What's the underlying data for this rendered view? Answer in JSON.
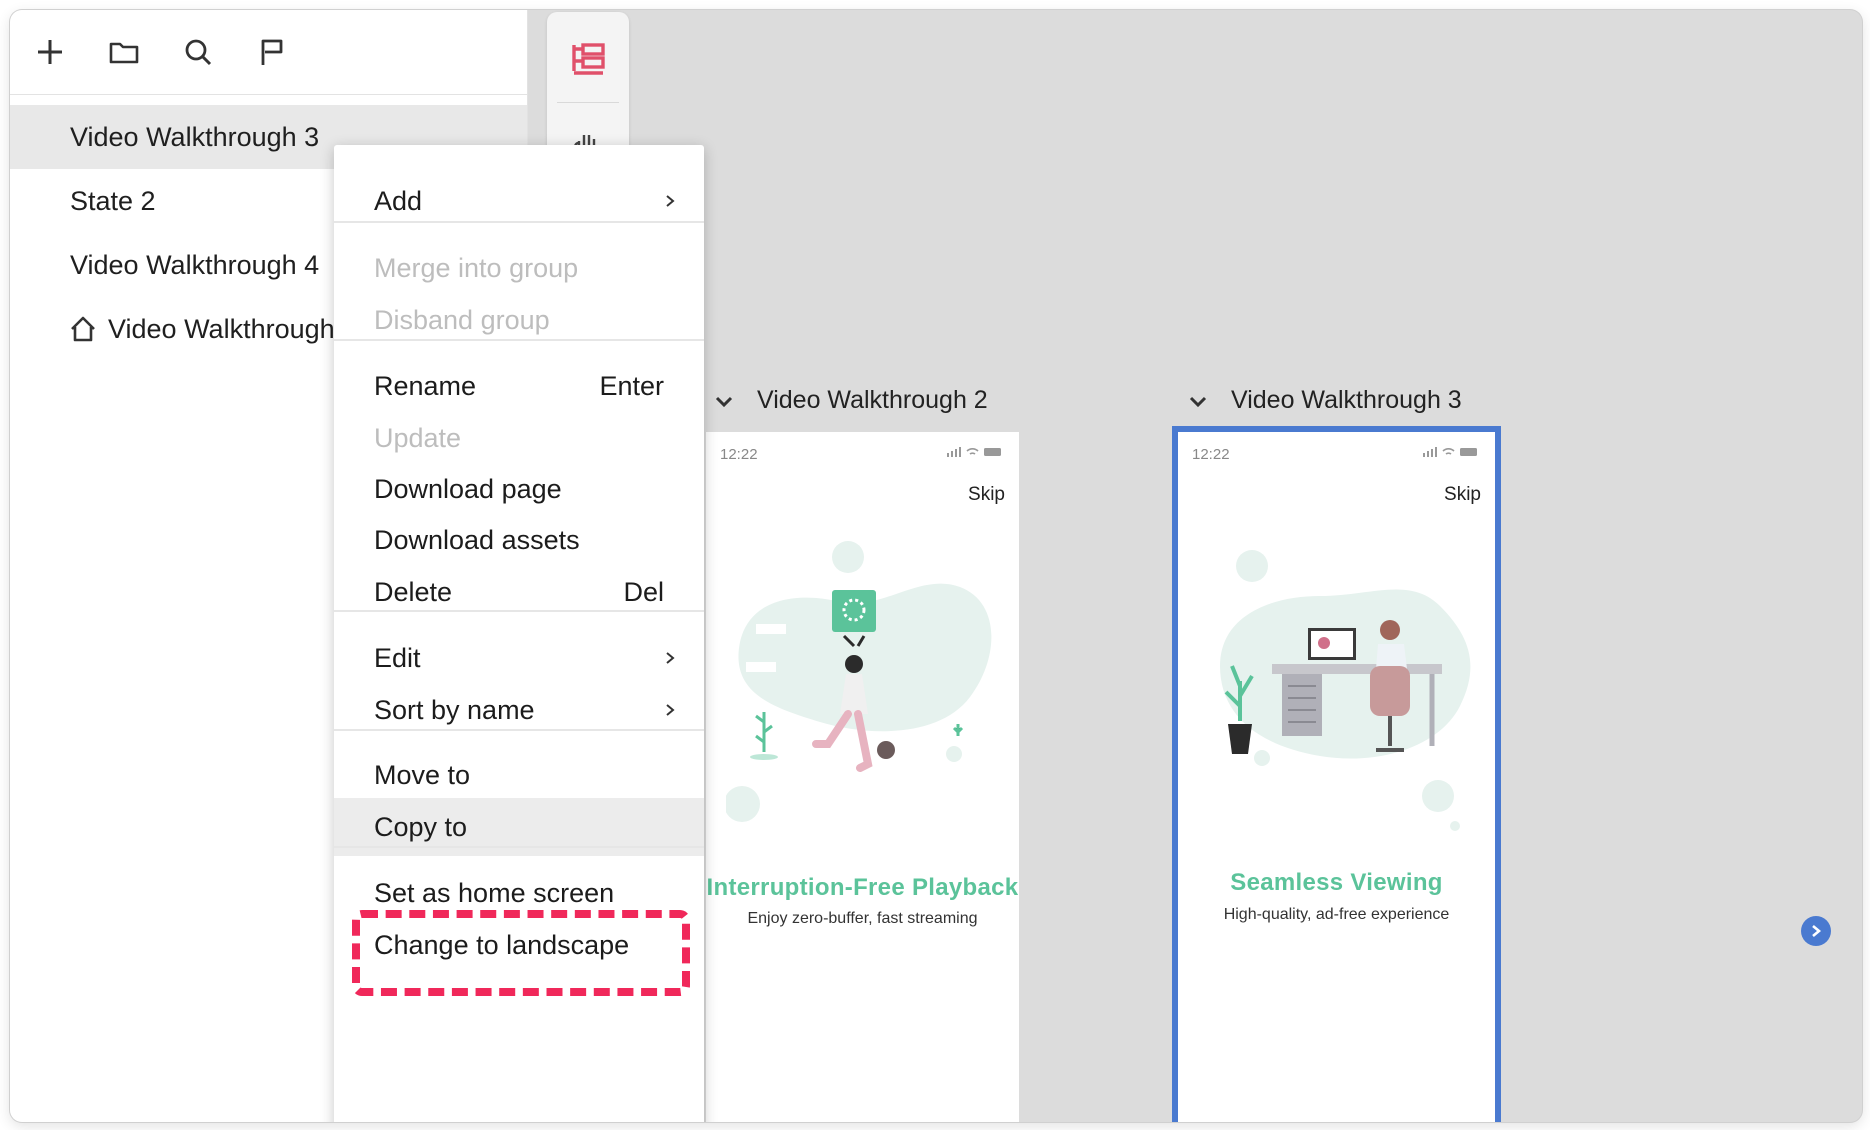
{
  "toolbar": {
    "icons": [
      "plus-icon",
      "folder-icon",
      "search-icon",
      "flag-icon"
    ]
  },
  "pages": [
    {
      "label": "Video Walkthrough 3",
      "selected": true
    },
    {
      "label": "State 2"
    },
    {
      "label": "Video Walkthrough 4"
    },
    {
      "label": "Video Walkthrough",
      "home": true
    }
  ],
  "context_menu": {
    "add": "Add",
    "merge": "Merge into group",
    "disband": "Disband group",
    "rename": "Rename",
    "rename_shortcut": "Enter",
    "update": "Update",
    "download_page": "Download page",
    "download_assets": "Download assets",
    "delete": "Delete",
    "delete_shortcut": "Del",
    "edit": "Edit",
    "sort": "Sort by name",
    "move_to": "Move to",
    "copy_to": "Copy to",
    "set_home": "Set as home screen",
    "landscape": "Change to landscape"
  },
  "frames": [
    {
      "name": "Video Walkthrough 2",
      "time": "12:22",
      "skip": "Skip",
      "title": "Interruption-Free Playback",
      "subtitle": "Enjoy zero-buffer, fast streaming"
    },
    {
      "name": "Video Walkthrough 3",
      "time": "12:22",
      "skip": "Skip",
      "title": "Seamless Viewing",
      "subtitle": "High-quality, ad-free experience"
    }
  ],
  "colors": {
    "accent": "#4a7ad0",
    "highlight": "#f0285a",
    "brand_green": "#5bc39a",
    "strip_icon": "#e0506a"
  }
}
